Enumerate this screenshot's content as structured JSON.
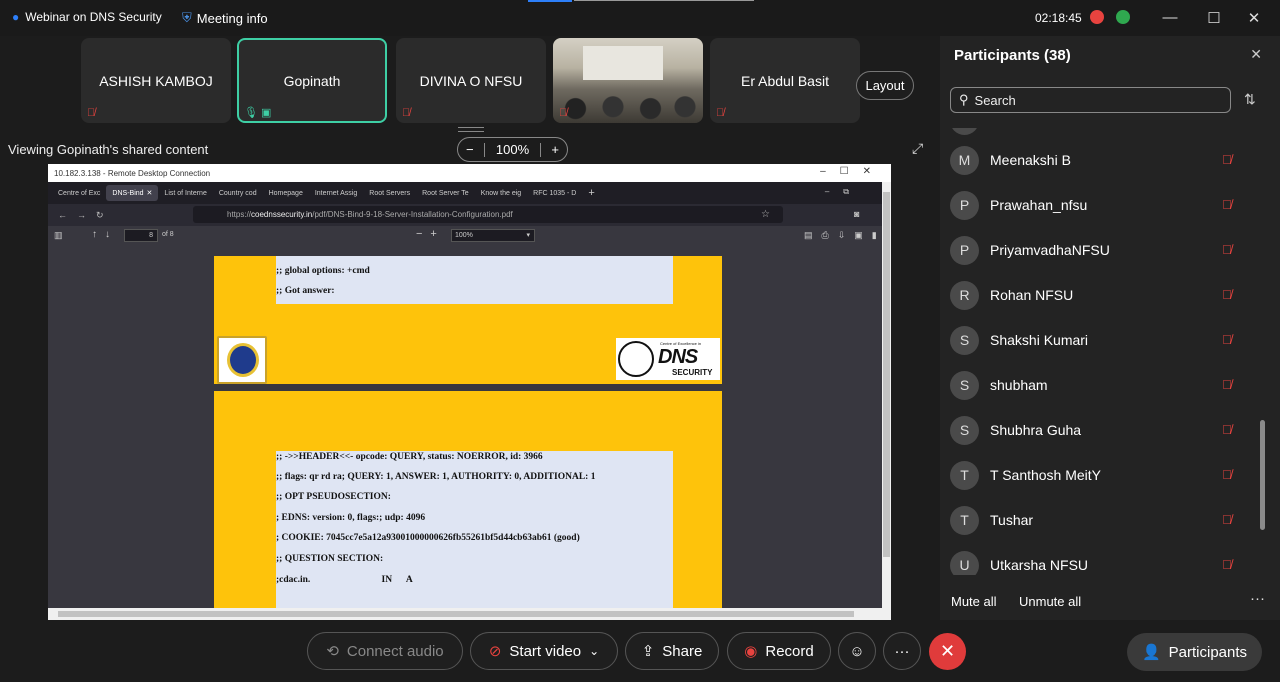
{
  "window": {
    "title": "Webinar on DNS Security",
    "meeting_info": "Meeting info",
    "clock": "02:18:45",
    "controls": [
      "—",
      "☐",
      "✕"
    ]
  },
  "thumbnails": [
    {
      "name": "ASHISH KAMBOJ",
      "muted": true
    },
    {
      "name": "Gopinath",
      "muted": false,
      "active": true
    },
    {
      "name": "DIVINA O NFSU",
      "muted": true
    },
    {
      "name": "",
      "video": true,
      "muted": true
    },
    {
      "name": "Er Abdul Basit",
      "muted": true
    }
  ],
  "layout_button": "Layout",
  "viewing_label": "Viewing Gopinath's shared content",
  "zoom": {
    "minus": "−",
    "value": "100%",
    "plus": "+"
  },
  "shared": {
    "rdp_title": "10.182.3.138 - Remote Desktop Connection",
    "tabs": [
      "Centre of Exc",
      "DNS-Bind",
      "List of Interne",
      "Country cod",
      "Homepage",
      "Internet Assig",
      "Root Servers",
      "Root Server Te",
      "Know the eig",
      "RFC 1035 - D"
    ],
    "url_prefix": "https://",
    "url_host": "coednssecurity.in",
    "url_path": "/pdf/DNS-Bind-9-18-Server-Installation-Configuration.pdf",
    "page_num": "8",
    "page_of": "of 8",
    "pdf_zoom": "100%",
    "page1_lines": [
      ";; global options: +cmd",
      ";; Got answer:"
    ],
    "page2_lines": [
      ";; ->>HEADER<<- opcode: QUERY, status: NOERROR, id: 3966",
      ";; flags: qr rd ra; QUERY: 1, ANSWER: 1, AUTHORITY: 0, ADDITIONAL: 1",
      ";; OPT PSEUDOSECTION:",
      "; EDNS: version: 0, flags:; udp: 4096",
      "; COOKIE: 7045cc7e5a12a930010000006​26fb55261bf5d44cb63ab61 (good)",
      ";; QUESTION SECTION:",
      ";cdac.in.                              IN      A"
    ],
    "logo_dns_small": "Centre of Excellence in",
    "logo_dns_big": "DNS",
    "logo_dns_sub": "SECURITY"
  },
  "toolbar": {
    "connect_audio": "Connect audio",
    "start_video": "Start video",
    "share": "Share",
    "record": "Record",
    "more": "···",
    "end": "✕",
    "participants": "Participants"
  },
  "panel": {
    "header": "Participants (38)",
    "search_placeholder": "Search",
    "participants": [
      {
        "initial": "M",
        "name": "Meenakshi B"
      },
      {
        "initial": "P",
        "name": "Prawahan_nfsu"
      },
      {
        "initial": "P",
        "name": "PriyamvadhaNFSU"
      },
      {
        "initial": "R",
        "name": "Rohan NFSU"
      },
      {
        "initial": "S",
        "name": "Shakshi Kumari"
      },
      {
        "initial": "S",
        "name": "shubham"
      },
      {
        "initial": "S",
        "name": "Shubhra Guha"
      },
      {
        "initial": "T",
        "name": "T Santhosh MeitY"
      },
      {
        "initial": "T",
        "name": "Tushar"
      },
      {
        "initial": "U",
        "name": "Utkarsha NFSU"
      }
    ],
    "mute_all": "Mute all",
    "unmute_all": "Unmute all"
  },
  "colors": {
    "accent": "#3ecfa5",
    "end": "#e03b3b",
    "muted_icon": "#e8433f",
    "pdf_yellow": "#fec30b"
  }
}
